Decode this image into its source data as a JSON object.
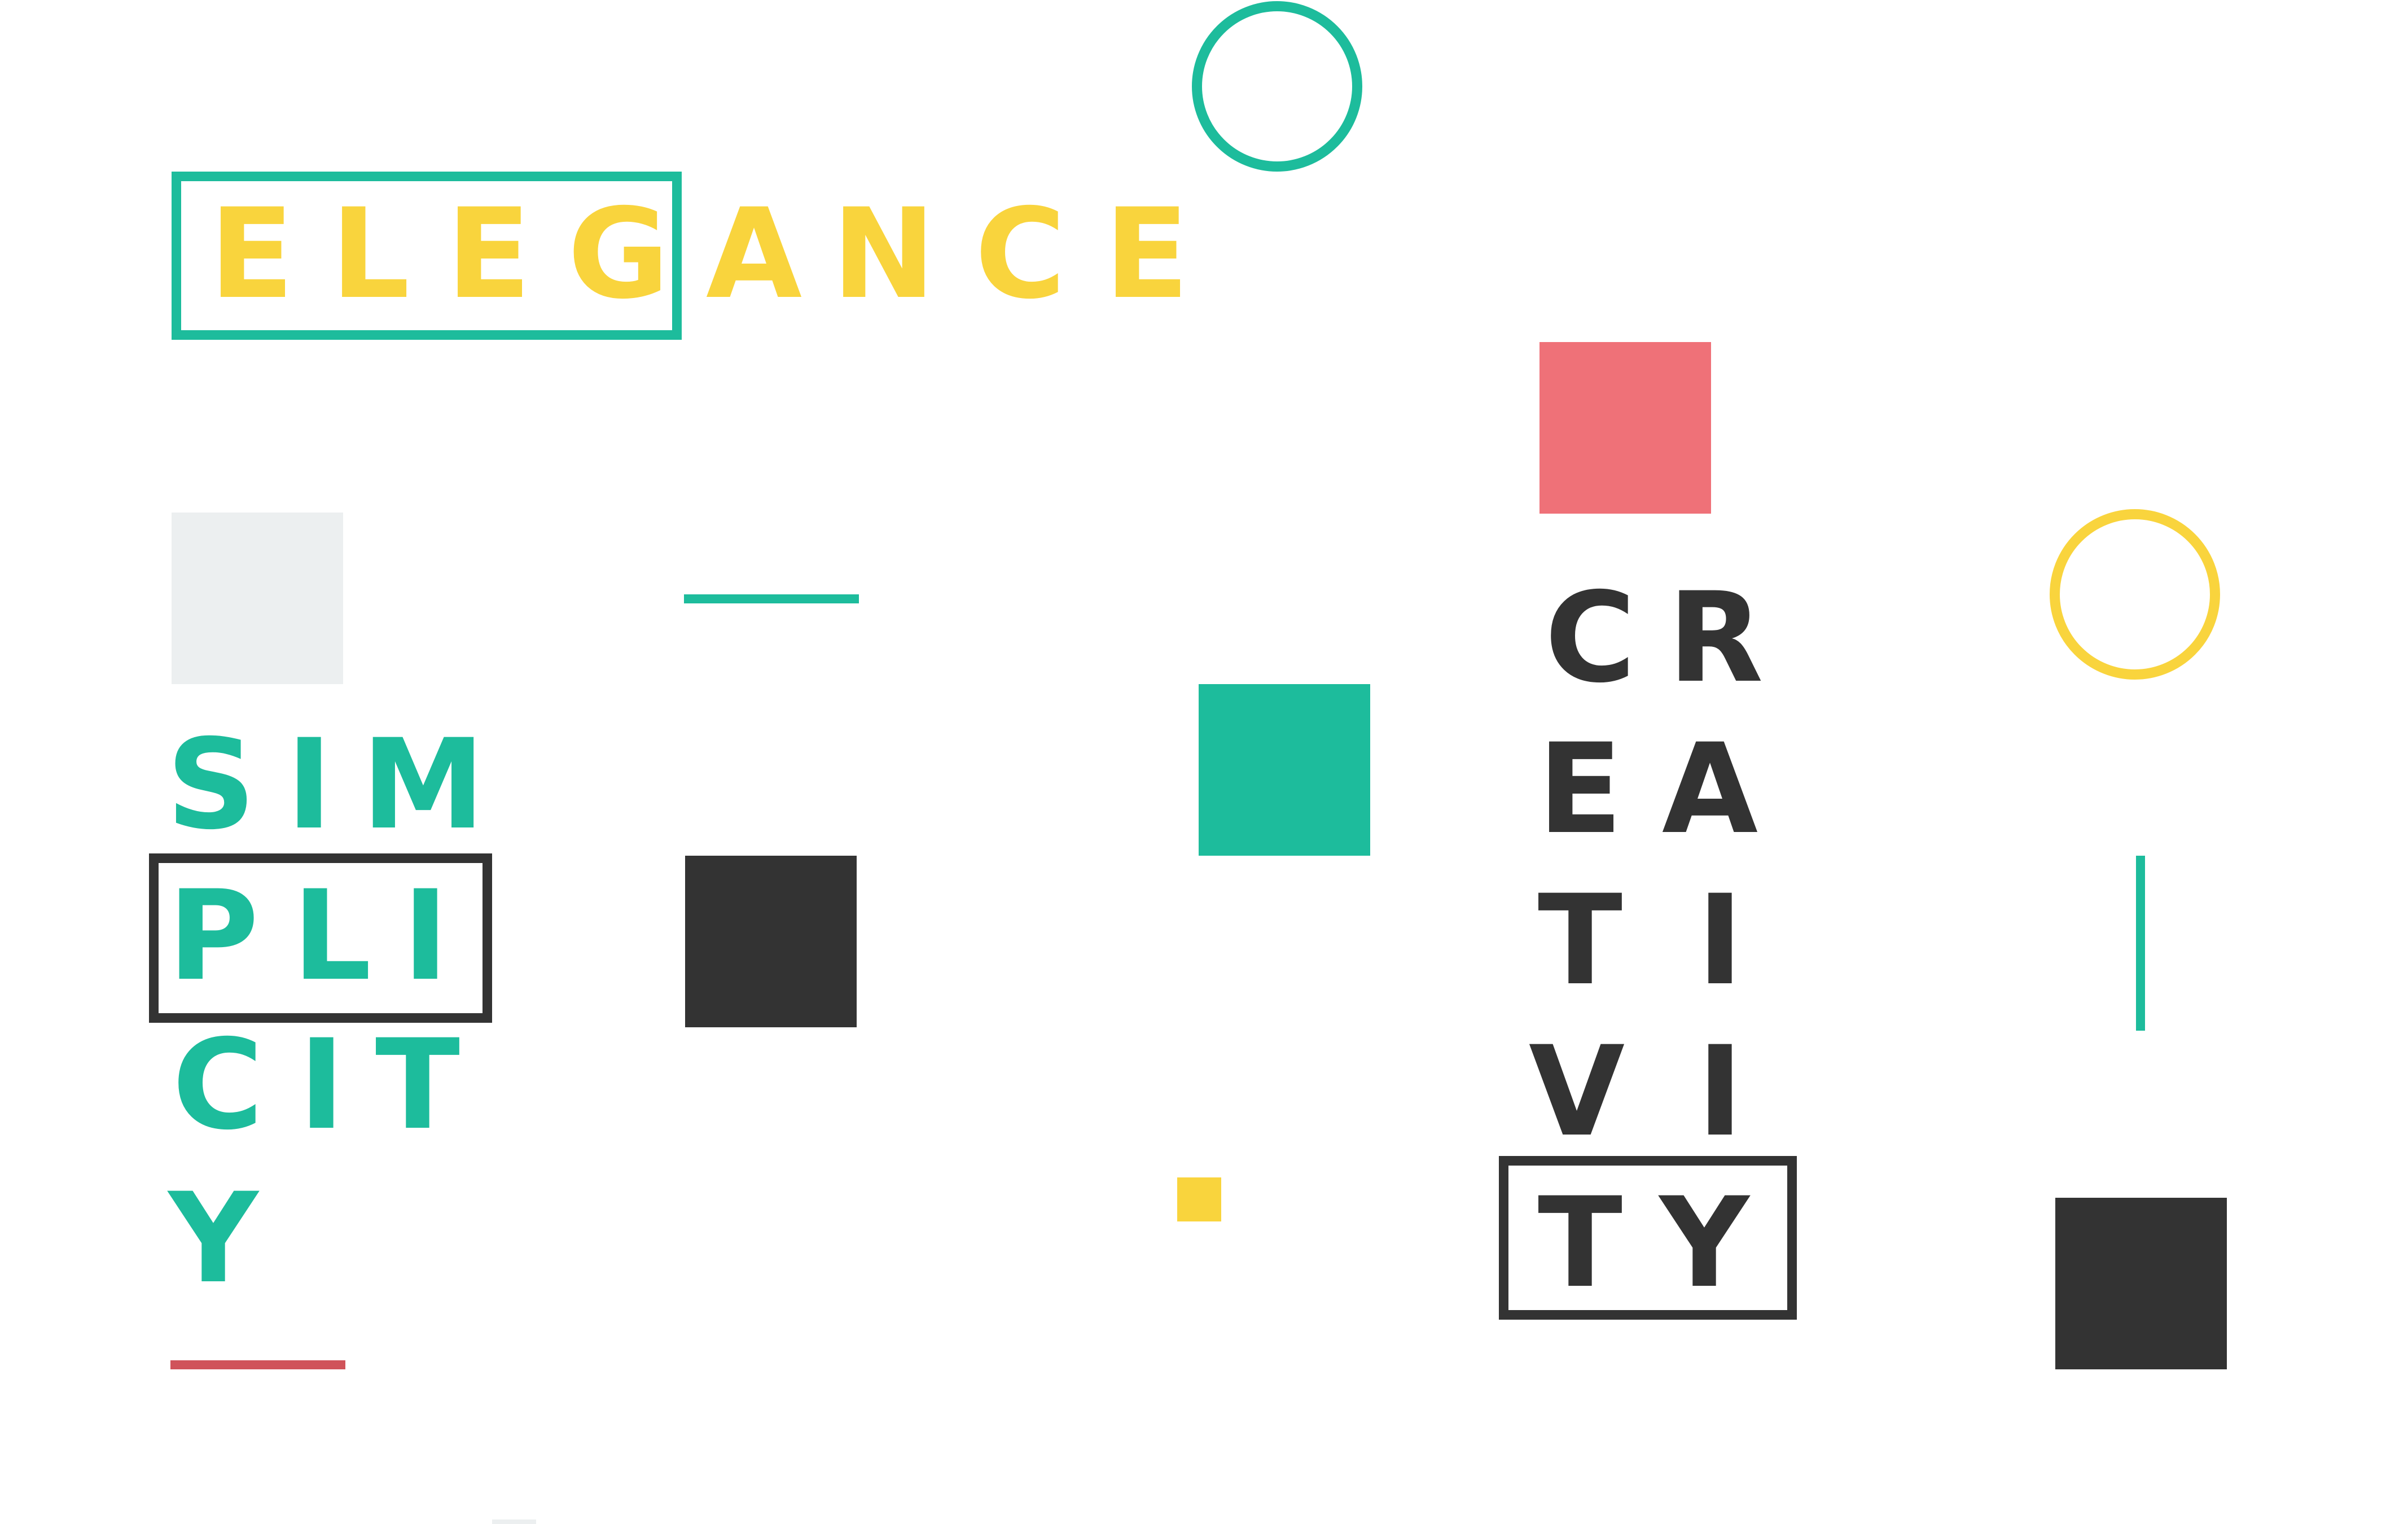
{
  "colors": {
    "yellow": "#F9D43D",
    "teal": "#1DBC9C",
    "dark": "#333333",
    "coral": "#EF7178",
    "red": "#D0535A",
    "light_gray": "#ECEFF0"
  },
  "words": {
    "elegance": [
      "E",
      "L",
      "E",
      "G",
      "A",
      "N",
      "C",
      "E"
    ],
    "simplicity": [
      "S",
      "I",
      "M",
      "P",
      "L",
      "I",
      "C",
      "I",
      "T",
      "Y"
    ],
    "creativity": [
      "C",
      "R",
      "E",
      "A",
      "T",
      "I",
      "V",
      "I",
      "T",
      "Y"
    ]
  }
}
